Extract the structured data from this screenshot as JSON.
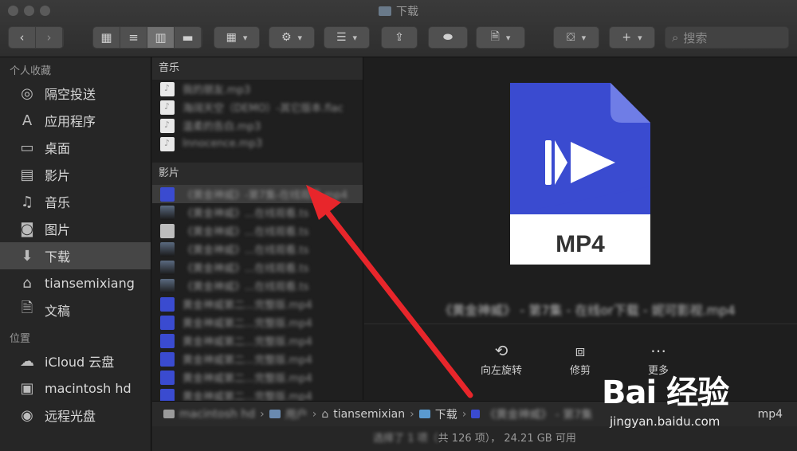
{
  "window": {
    "title": "下载"
  },
  "toolbar": {
    "search_placeholder": "搜索",
    "icons": [
      "back-icon",
      "forward-icon",
      "icon-view-icon",
      "list-view-icon",
      "column-view-icon",
      "gallery-view-icon",
      "group-icon",
      "gear-icon",
      "arrange-icon",
      "share-icon",
      "tag-icon",
      "new-document-icon",
      "storage-icon",
      "add-icon",
      "search-icon"
    ]
  },
  "sidebar": {
    "sections": [
      {
        "header": "个人收藏",
        "items": [
          {
            "label": "隔空投送",
            "icon": "airdrop-icon"
          },
          {
            "label": "应用程序",
            "icon": "applications-icon"
          },
          {
            "label": "桌面",
            "icon": "desktop-icon"
          },
          {
            "label": "影片",
            "icon": "movies-icon"
          },
          {
            "label": "音乐",
            "icon": "music-icon"
          },
          {
            "label": "图片",
            "icon": "pictures-icon"
          },
          {
            "label": "下载",
            "icon": "downloads-icon",
            "selected": true
          },
          {
            "label": "tiansemixiang",
            "icon": "home-icon"
          },
          {
            "label": "文稿",
            "icon": "documents-icon"
          }
        ]
      },
      {
        "header": "位置",
        "items": [
          {
            "label": "iCloud 云盘",
            "icon": "cloud-icon"
          },
          {
            "label": "macintosh hd",
            "icon": "disk-icon"
          },
          {
            "label": "远程光盘",
            "icon": "optical-disc-icon"
          }
        ]
      }
    ]
  },
  "browser": {
    "music_header": "音乐",
    "music_files": [
      "我的朋友.mp3",
      "海阔天空（DEMO）-其它版本.flac",
      "温柔的告白.mp3",
      "Innocence.mp3"
    ],
    "movies_header": "影片",
    "movie_files": [
      "《黄金神威》-第7集-在线观看.mp4",
      "《黄金神威》...在线观看.ts",
      "《黄金神威》...在线观看.ts",
      "《黄金神威》...在线观看.ts",
      "《黄金神威》...在线观看.ts",
      "《黄金神威》...在线观看.ts",
      "黄金神威第二...完整版.mp4",
      "黄金神威第二...完整版.mp4",
      "黄金神威第二...完整版.mp4",
      "黄金神威第二...完整版.mp4",
      "黄金神威第二...完整版.mp4",
      "黄金神威第二...完整版.mp4"
    ]
  },
  "preview": {
    "file_type": "MP4",
    "file_name": "《黄金神威》 - 第7集 - 在线or下载 - 妮可影视.mp4",
    "actions": [
      {
        "label": "向左旋转",
        "icon": "rotate-left-icon"
      },
      {
        "label": "修剪",
        "icon": "trim-icon"
      },
      {
        "label": "更多",
        "icon": "more-icon"
      }
    ]
  },
  "pathbar": {
    "segments": [
      "macintosh hd",
      "用户",
      "tiansemixian",
      "下载",
      "《黄金神威》 - 第7集"
    ],
    "tail": "mp4"
  },
  "status": {
    "prefix": "选择了 1 项（",
    "text": "共 126 项）， 24.21 GB 可用"
  },
  "watermark": {
    "brand": "Bai 经验",
    "url": "jingyan.baidu.com"
  },
  "colors": {
    "mp4_blue": "#3a4bd0",
    "arrow_red": "#e8262b"
  }
}
